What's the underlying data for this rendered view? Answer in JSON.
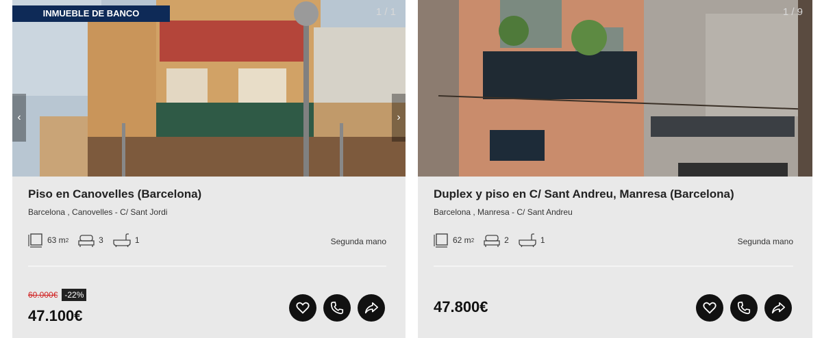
{
  "listings": [
    {
      "badge": "INMUEBLE DE BANCO",
      "photo_counter": "1 / 1",
      "title": "Piso en Canovelles (Barcelona)",
      "address": "Barcelona , Canovelles - C/ Sant Jordi",
      "area": "63 m",
      "area_unit_sup": "2",
      "bedrooms": "3",
      "bathrooms": "1",
      "condition": "Segunda mano",
      "old_price": "60.000€",
      "discount": "-22%",
      "price": "47.100€",
      "nav_prev": "‹",
      "nav_next": "›"
    },
    {
      "photo_counter": "1 / 9",
      "title": "Duplex y piso en C/ Sant Andreu, Manresa (Barcelona)",
      "address": "Barcelona , Manresa - C/ Sant Andreu",
      "area": "62 m",
      "area_unit_sup": "2",
      "bedrooms": "2",
      "bathrooms": "1",
      "condition": "Segunda mano",
      "price": "47.800€"
    }
  ],
  "icons": {
    "area": "area-icon",
    "bedroom": "bed-icon",
    "bathroom": "bathtub-icon",
    "favorite": "heart-icon",
    "call": "phone-icon",
    "share": "share-icon"
  },
  "colors": {
    "badge_bg": "#0e2a57",
    "old_price": "#d02020",
    "action_bg": "#111111",
    "card_bg": "#e9e9e9"
  }
}
